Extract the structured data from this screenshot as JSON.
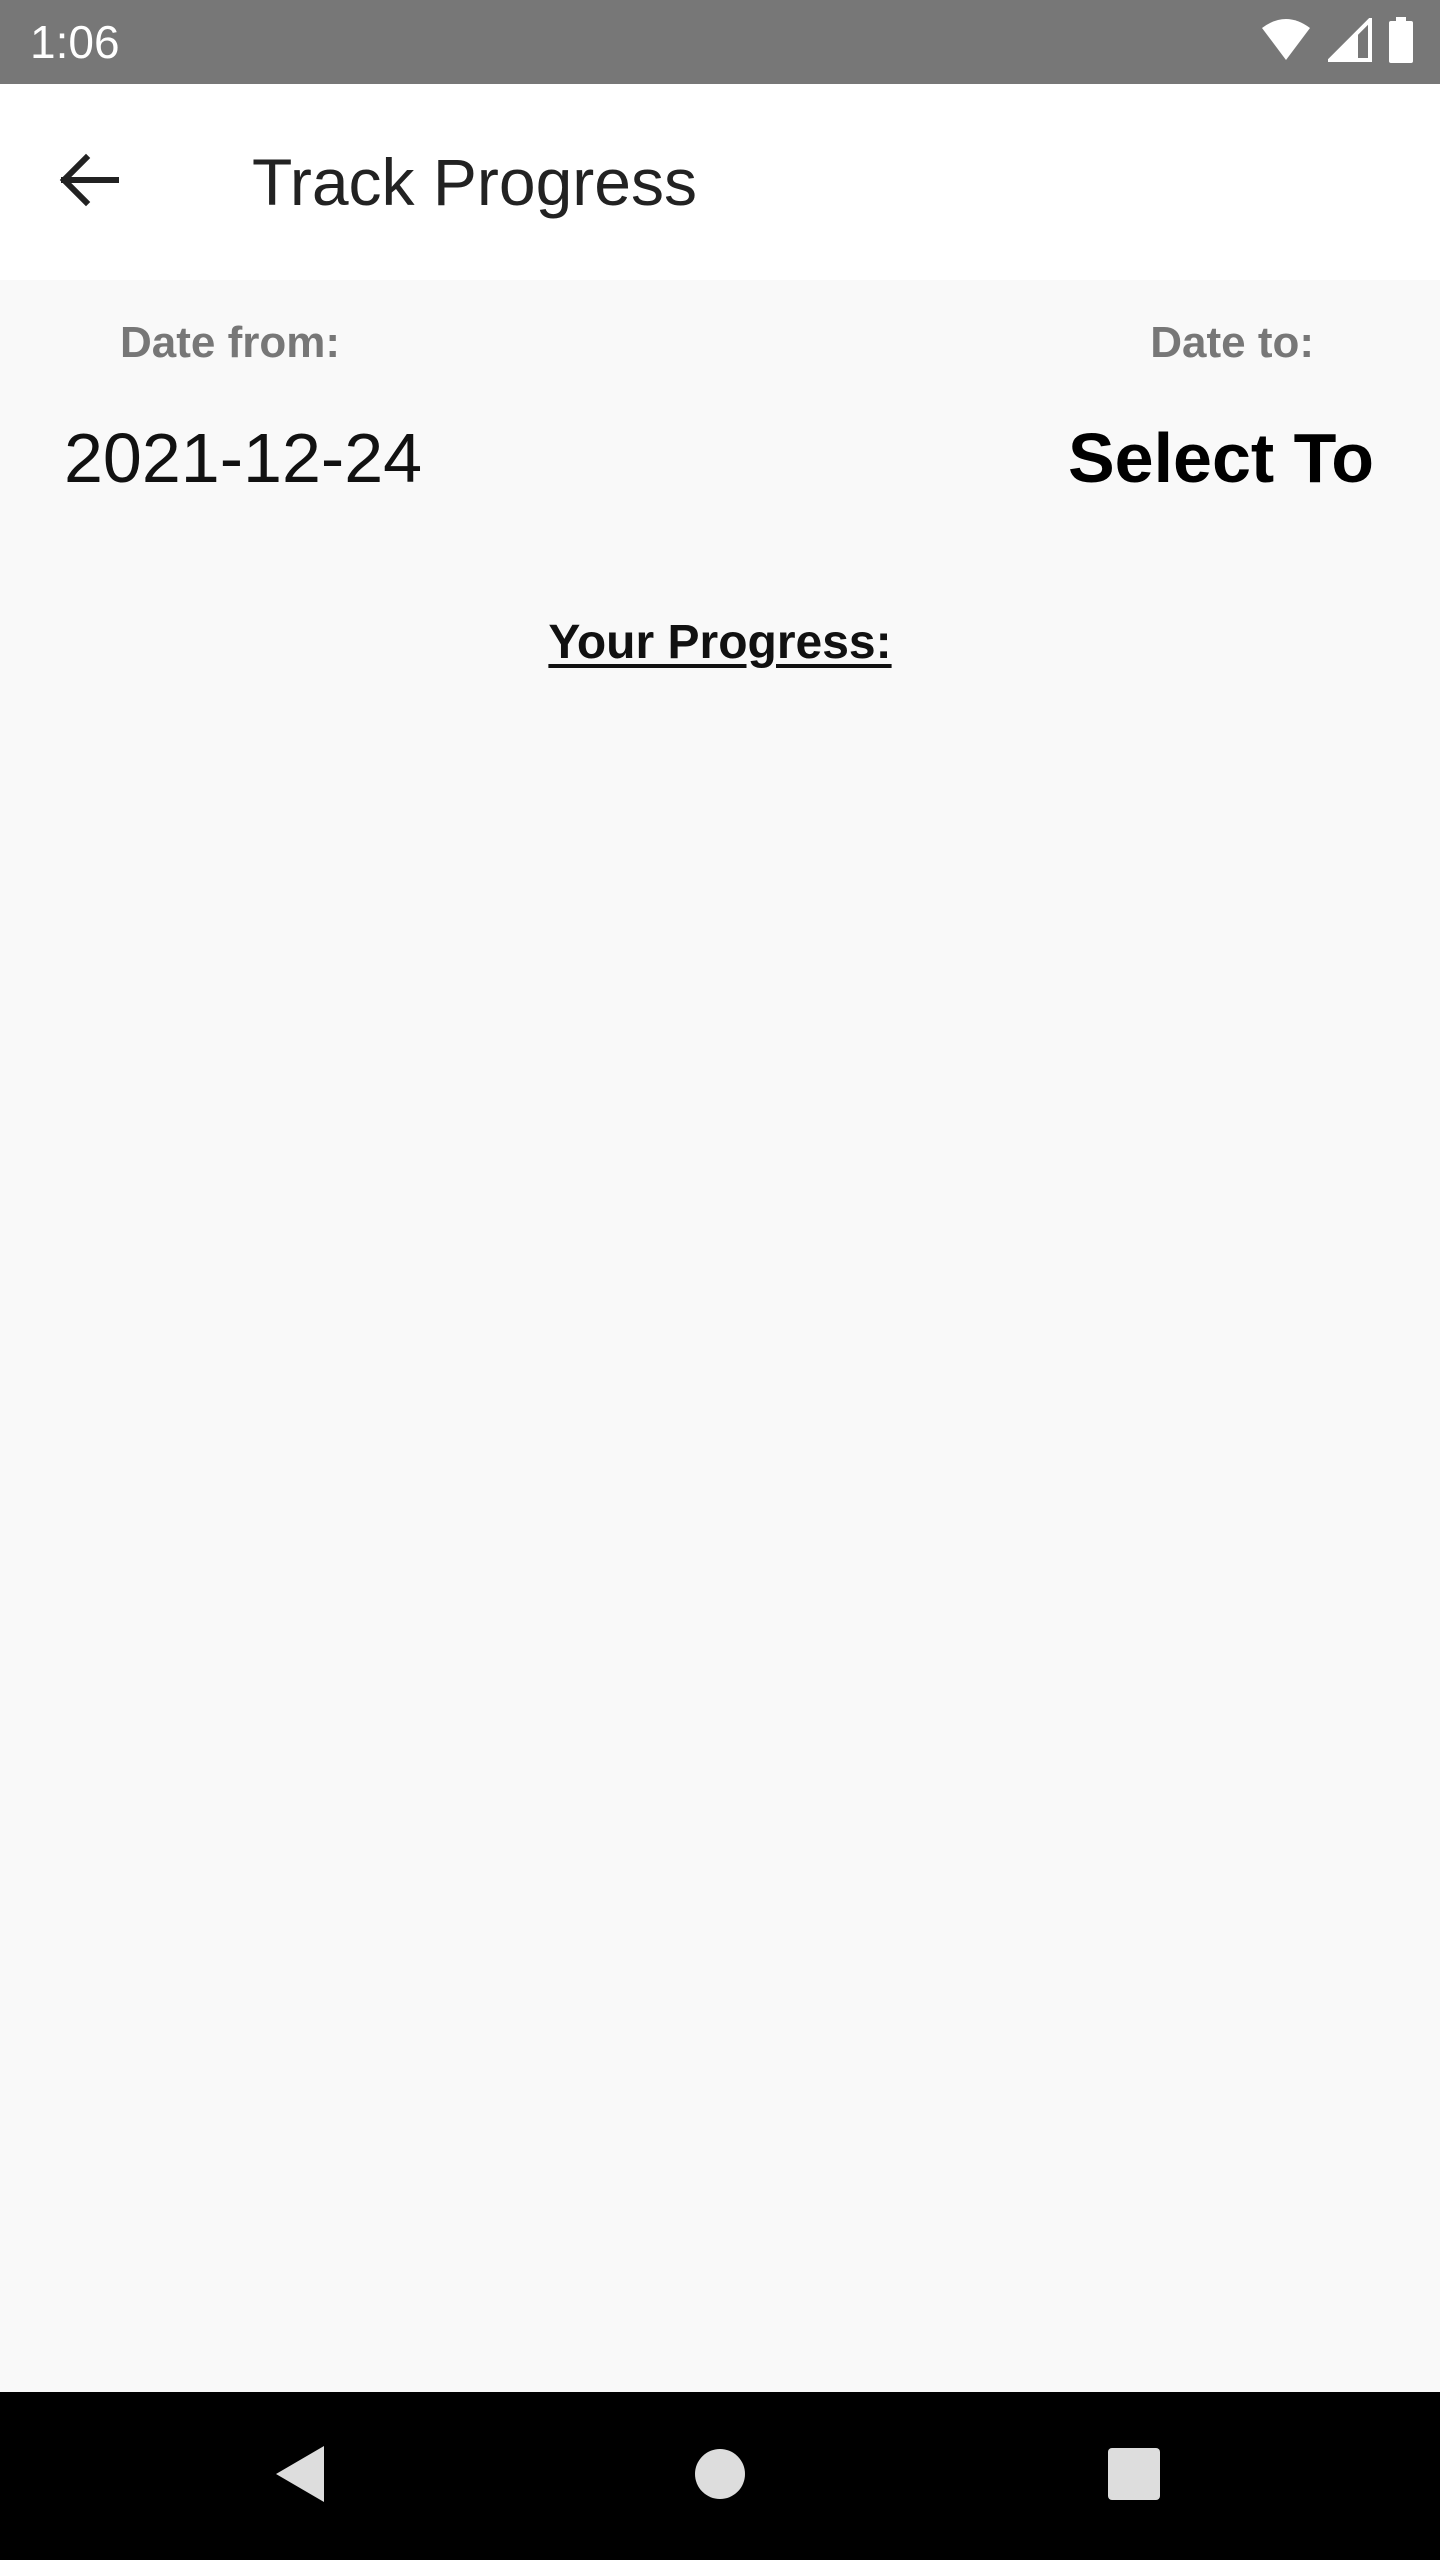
{
  "status_bar": {
    "time": "1:06",
    "icons": [
      "wifi-icon",
      "cell-signal-icon",
      "battery-icon"
    ]
  },
  "app_bar": {
    "back_icon": "arrow-back-icon",
    "title": "Track Progress"
  },
  "dates": {
    "from_label": "Date from:",
    "from_value": "2021-12-24",
    "to_label": "Date to:",
    "to_value": "Select To"
  },
  "progress": {
    "heading": "Your Progress:"
  },
  "nav_bar": {
    "icons": [
      "nav-back-icon",
      "nav-home-icon",
      "nav-recents-icon"
    ]
  },
  "colors": {
    "status_bar": "#777777",
    "app_bar": "#ffffff",
    "background": "#f9f9f9",
    "nav_bar": "#000000",
    "label_gray": "#777777"
  }
}
